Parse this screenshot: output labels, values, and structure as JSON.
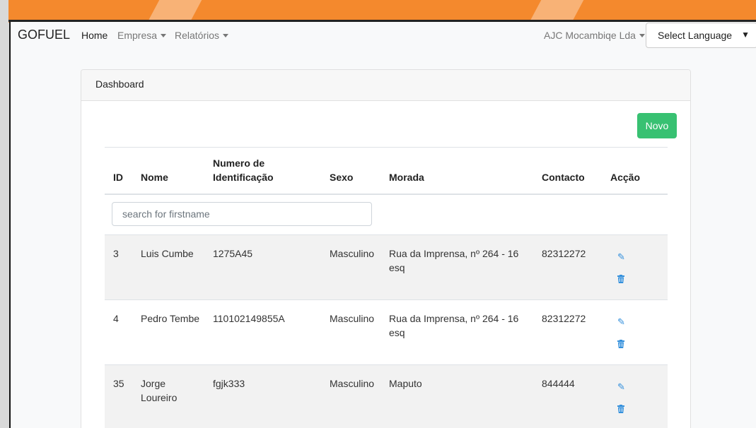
{
  "navbar": {
    "brand": "GOFUEL",
    "home": "Home",
    "empresa": "Empresa",
    "relatorios": "Relatórios",
    "company": "AJC Mocambiqe Lda",
    "language_select": "Select Language",
    "language_arrow": "▼"
  },
  "card": {
    "header": "Dashboard",
    "new_button": "Novo"
  },
  "table": {
    "columns": {
      "id": "ID",
      "nome": "Nome",
      "numero_line1": "Numero de",
      "numero_line2": "Identificação",
      "sexo": "Sexo",
      "morada": "Morada",
      "contacto": "Contacto",
      "accao": "Acção"
    },
    "search_placeholder": "search for firstname",
    "rows": [
      {
        "id": "3",
        "nome": "Luis Cumbe",
        "numero": "1275A45",
        "sexo": "Masculino",
        "morada": "Rua da Imprensa, nº 264 - 16 esq",
        "contacto": "82312272"
      },
      {
        "id": "4",
        "nome": "Pedro Tembe",
        "numero": "110102149855A",
        "sexo": "Masculino",
        "morada": "Rua da Imprensa, nº 264 - 16 esq",
        "contacto": "82312272"
      },
      {
        "id": "35",
        "nome": "Jorge Loureiro",
        "numero": "fgjk333",
        "sexo": "Masculino",
        "morada": "Maputo",
        "contacto": "844444"
      }
    ]
  },
  "colors": {
    "accent_orange": "#f4892d",
    "novo_green": "#38c172",
    "icon_blue": "#3490dc"
  },
  "icons": {
    "edit": "pencil-icon",
    "delete": "trash-icon"
  }
}
